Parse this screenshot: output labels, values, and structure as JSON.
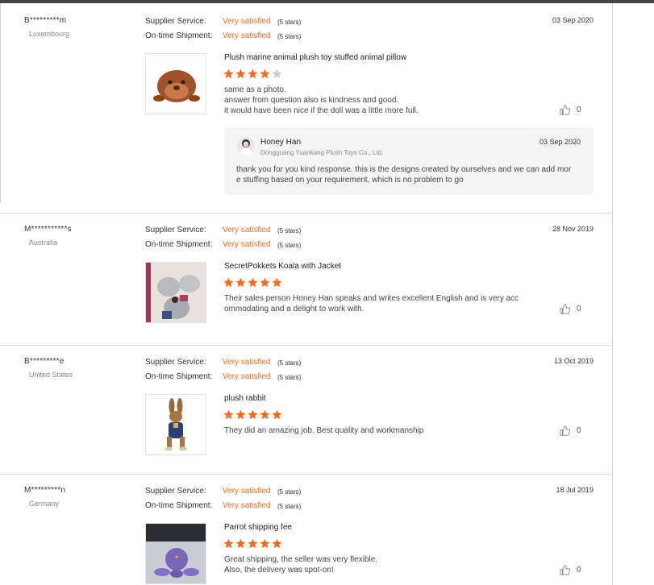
{
  "colors": {
    "accent": "#f36c21",
    "star_on": "#f36c21",
    "star_off": "#cccccc"
  },
  "reviews": [
    {
      "buyer": "B*********m",
      "country": "Luxembourg",
      "supplier_label": "Supplier Service:",
      "supplier_value": "Very satisfied",
      "supplier_stars": "(5 stars)",
      "shipment_label": "On-time Shipment:",
      "shipment_value": "Very satisfied",
      "shipment_stars": "(5 stars)",
      "date": "03 Sep 2020",
      "product": "Plush marine animal plush toy stuffed animal pillow",
      "rating": 4,
      "comment": [
        "same as a photo.",
        "answer from question also is kindness and good.",
        "it would have been nice if the doll was a little more full."
      ],
      "likes": "0",
      "reply": {
        "name": "Honey Han",
        "company": "Dongguang Yuankang Plush Toys Co., Ltd.",
        "date": "03 Sep 2020",
        "text": [
          "thank you for you kind response.  this is the designs created by ourselves and we can add mor",
          "e stuffing based on your requirement, which is no problem to go"
        ]
      }
    },
    {
      "buyer": "M***********s",
      "country": "Australia",
      "supplier_label": "Supplier Service:",
      "supplier_value": "Very satisfied",
      "supplier_stars": "(5 stars)",
      "shipment_label": "On-time Shipment:",
      "shipment_value": "Very satisfied",
      "shipment_stars": "(5 stars)",
      "date": "28 Nov 2019",
      "product": "SecretPokkets Koala with Jacket",
      "rating": 5,
      "comment": [
        "Their sales person Honey Han speaks and writes excellent English and is very acc",
        "ommodating and a delight to work with."
      ],
      "likes": "0"
    },
    {
      "buyer": "B*********e",
      "country": "United States",
      "supplier_label": "Supplier Service:",
      "supplier_value": "Very satisfied",
      "supplier_stars": "(5 stars)",
      "shipment_label": "On-time Shipment:",
      "shipment_value": "Very satisfied",
      "shipment_stars": "(5 stars)",
      "date": "13 Oct 2019",
      "product": "plush rabbit",
      "rating": 5,
      "comment": [
        "They did an amazing job. Best quality and workmanship"
      ],
      "likes": "0"
    },
    {
      "buyer": "M*********n",
      "country": "Germany",
      "supplier_label": "Supplier Service:",
      "supplier_value": "Very satisfied",
      "supplier_stars": "(5 stars)",
      "shipment_label": "On-time Shipment:",
      "shipment_value": "Very satisfied",
      "shipment_stars": "(5 stars)",
      "date": "18 Jul 2019",
      "product": "Parrot shipping fee",
      "rating": 5,
      "comment": [
        "Great shipping, the seller was very flexible.",
        "Also, the delivery was spot-on!"
      ],
      "likes": "0"
    }
  ]
}
